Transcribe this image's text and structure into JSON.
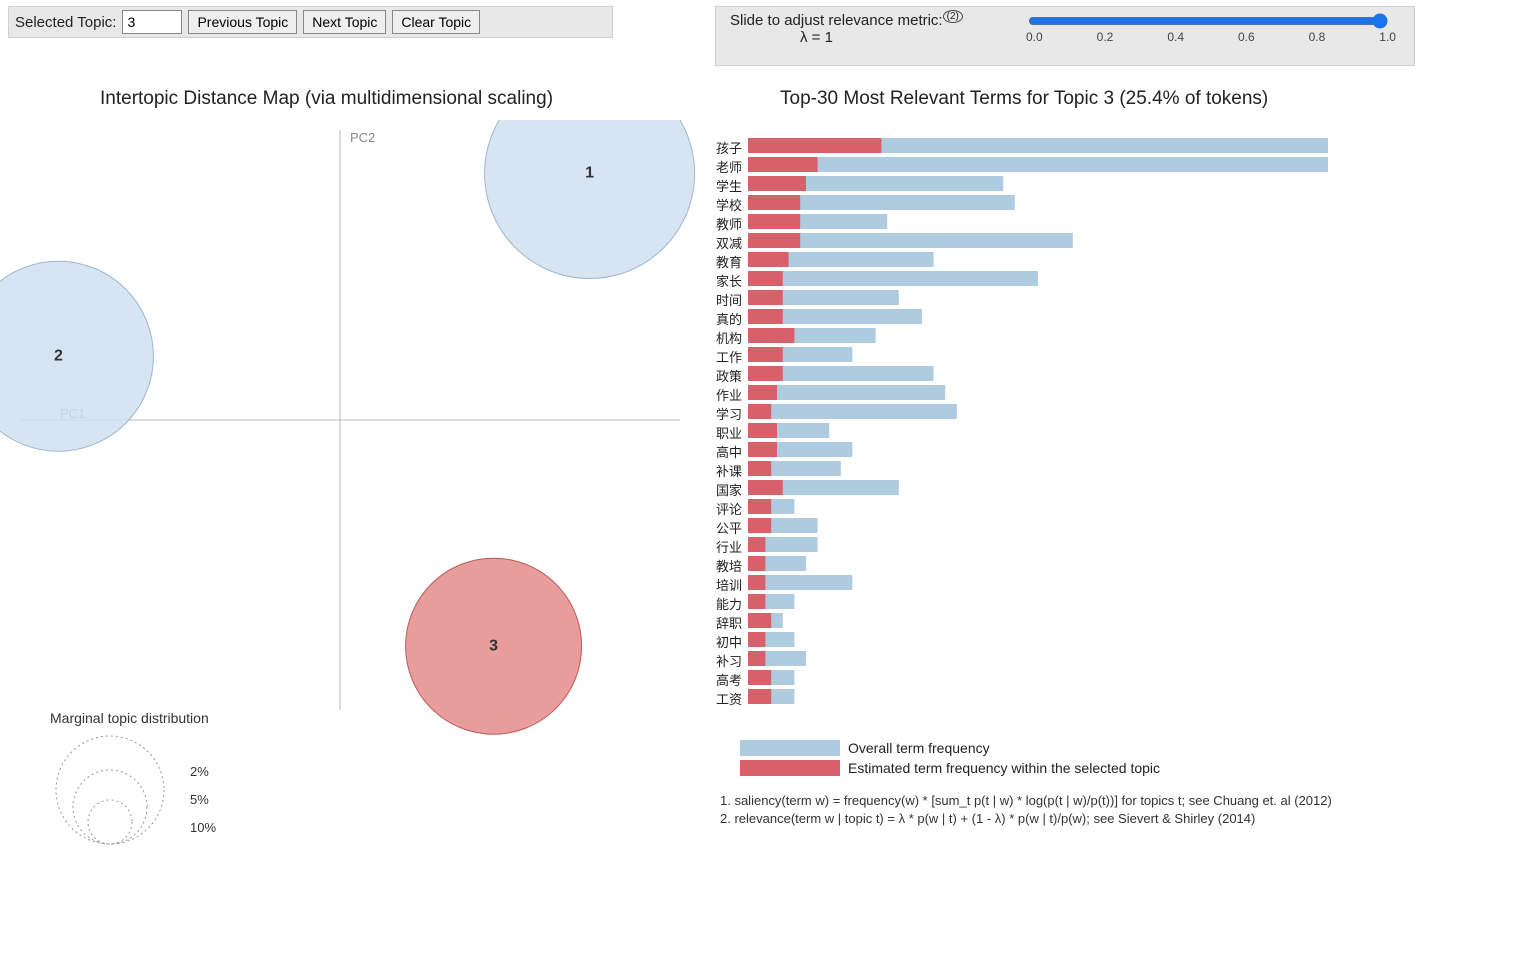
{
  "controls": {
    "selected_label": "Selected Topic:",
    "selected_value": "3",
    "prev_btn": "Previous Topic",
    "next_btn": "Next Topic",
    "clear_btn": "Clear Topic"
  },
  "slider": {
    "label_prefix": "Slide to adjust relevance metric:",
    "info_badge": "(2)",
    "lambda_text": "λ = 1",
    "value": 1.0,
    "ticks": [
      "0.0",
      "0.2",
      "0.4",
      "0.6",
      "0.8",
      "1.0"
    ]
  },
  "left_title": "Intertopic Distance Map (via multidimensional scaling)",
  "right_title": "Top-30 Most Relevant Terms for Topic 3 (25.4% of tokens)",
  "axes": {
    "x": "PC1",
    "y": "PC2"
  },
  "legend_marginal": {
    "title": "Marginal topic distribution",
    "levels": [
      {
        "pct": "2%",
        "r": 22
      },
      {
        "pct": "5%",
        "r": 37
      },
      {
        "pct": "10%",
        "r": 54
      }
    ]
  },
  "bar_legend": {
    "overall": "Overall term frequency",
    "within": "Estimated term frequency within the selected topic"
  },
  "footer": {
    "l1": "1. saliency(term w) = frequency(w) * [sum_t p(t | w) * log(p(t | w)/p(t))] for topics t; see Chuang et. al (2012)",
    "l2": "2. relevance(term w | topic t) = λ * p(w | t) + (1 - λ) * p(w | t)/p(w); see Sievert & Shirley (2014)"
  },
  "chart_data": {
    "bubbles": {
      "type": "scatter",
      "title": "Intertopic Distance Map (via multidimensional scaling)",
      "xlabel": "PC1",
      "ylabel": "PC2",
      "xlim": [
        -1,
        1
      ],
      "ylim": [
        -1,
        1
      ],
      "points": [
        {
          "id": 1,
          "x": 0.78,
          "y": 0.85,
          "r": 105,
          "selected": false,
          "share_pct": 42.0
        },
        {
          "id": 2,
          "x": -0.88,
          "y": 0.22,
          "r": 95,
          "selected": false,
          "share_pct": 32.6
        },
        {
          "id": 3,
          "x": 0.48,
          "y": -0.78,
          "r": 88,
          "selected": true,
          "share_pct": 25.4
        }
      ]
    },
    "bars": {
      "type": "bar",
      "title": "Top-30 Most Relevant Terms for Topic 3 (25.4% of tokens)",
      "xlabel": "",
      "ylabel": "",
      "x_unit": "relative term frequency",
      "xlim": [
        0,
        100
      ],
      "series_labels": {
        "overall": "Overall term frequency",
        "within": "Estimated term frequency within the selected topic"
      },
      "terms": [
        {
          "term": "孩子",
          "overall": 100,
          "within": 23
        },
        {
          "term": "老师",
          "overall": 100,
          "within": 12
        },
        {
          "term": "学生",
          "overall": 44,
          "within": 10
        },
        {
          "term": "学校",
          "overall": 46,
          "within": 9
        },
        {
          "term": "教师",
          "overall": 24,
          "within": 9
        },
        {
          "term": "双减",
          "overall": 56,
          "within": 9
        },
        {
          "term": "教育",
          "overall": 32,
          "within": 7
        },
        {
          "term": "家长",
          "overall": 50,
          "within": 6
        },
        {
          "term": "时间",
          "overall": 26,
          "within": 6
        },
        {
          "term": "真的",
          "overall": 30,
          "within": 6
        },
        {
          "term": "机构",
          "overall": 22,
          "within": 8
        },
        {
          "term": "工作",
          "overall": 18,
          "within": 6
        },
        {
          "term": "政策",
          "overall": 32,
          "within": 6
        },
        {
          "term": "作业",
          "overall": 34,
          "within": 5
        },
        {
          "term": "学习",
          "overall": 36,
          "within": 4
        },
        {
          "term": "职业",
          "overall": 14,
          "within": 5
        },
        {
          "term": "高中",
          "overall": 18,
          "within": 5
        },
        {
          "term": "补课",
          "overall": 16,
          "within": 4
        },
        {
          "term": "国家",
          "overall": 26,
          "within": 6
        },
        {
          "term": "评论",
          "overall": 8,
          "within": 4
        },
        {
          "term": "公平",
          "overall": 12,
          "within": 4
        },
        {
          "term": "行业",
          "overall": 12,
          "within": 3
        },
        {
          "term": "教培",
          "overall": 10,
          "within": 3
        },
        {
          "term": "培训",
          "overall": 18,
          "within": 3
        },
        {
          "term": "能力",
          "overall": 8,
          "within": 3
        },
        {
          "term": "辞职",
          "overall": 6,
          "within": 4
        },
        {
          "term": "初中",
          "overall": 8,
          "within": 3
        },
        {
          "term": "补习",
          "overall": 10,
          "within": 3
        },
        {
          "term": "高考",
          "overall": 8,
          "within": 4
        },
        {
          "term": "工资",
          "overall": 8,
          "within": 4
        }
      ]
    }
  }
}
